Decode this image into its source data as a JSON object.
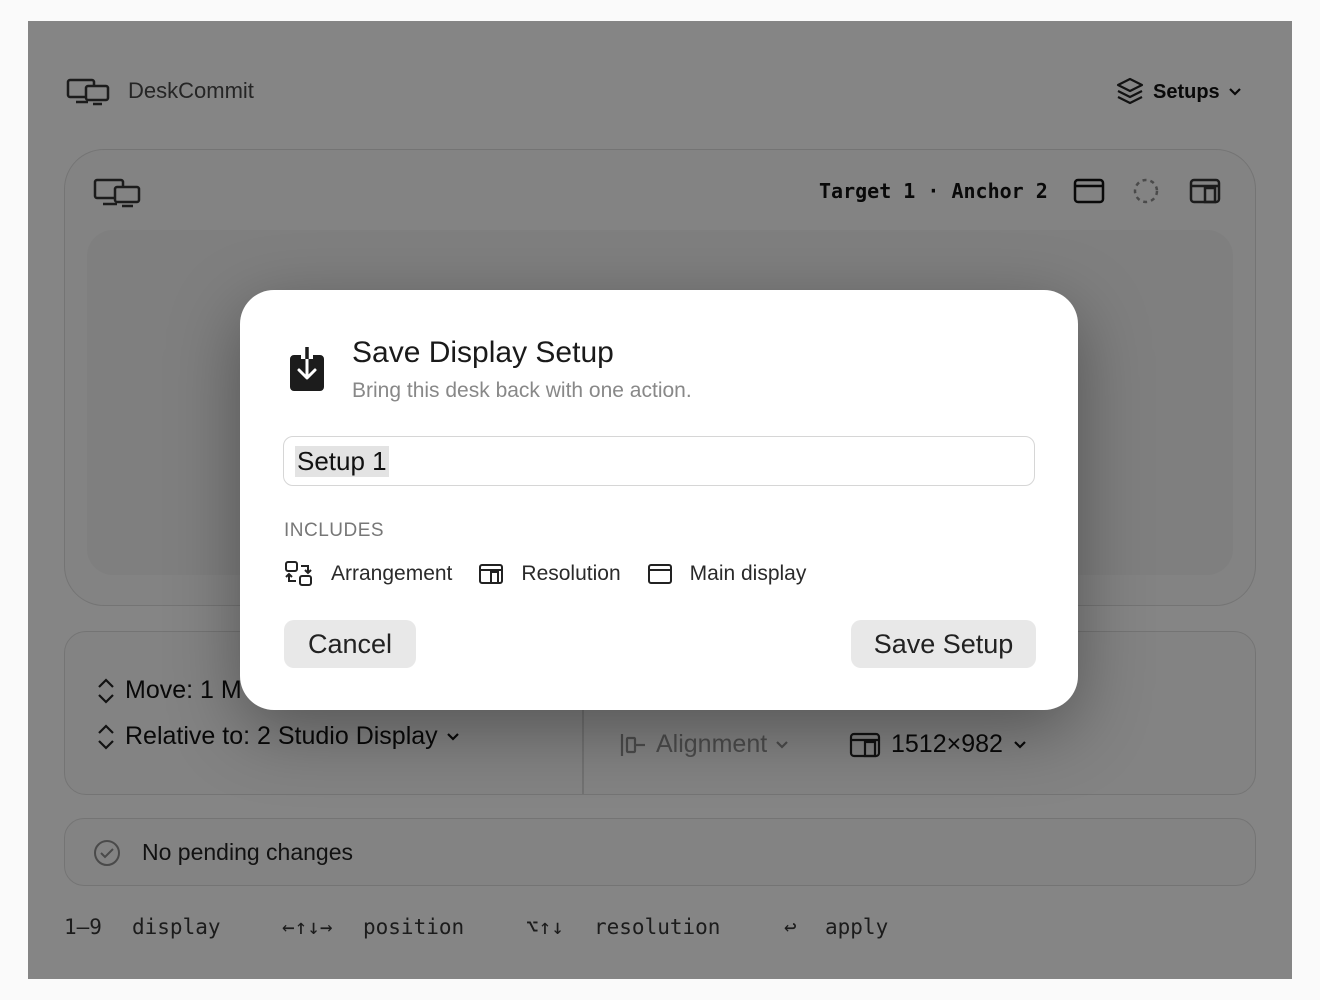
{
  "app": {
    "title": "DeskCommit",
    "setups_label": "Setups"
  },
  "preview": {
    "target_anchor": "Target 1 · Anchor 2"
  },
  "controls": {
    "move_label": "Move: 1 M",
    "relative_label": "Relative to: 2 Studio Display",
    "alignment_label": "Alignment",
    "resolution_value": "1512×982"
  },
  "status": {
    "text": "No pending changes"
  },
  "shortcuts": [
    {
      "key": "1–9",
      "action": "display"
    },
    {
      "key": "←↑↓→",
      "action": "position"
    },
    {
      "key": "⌥↑↓",
      "action": "resolution"
    },
    {
      "key": "↩",
      "action": "apply"
    }
  ],
  "dialog": {
    "title": "Save Display Setup",
    "subtitle": "Bring this desk back with one action.",
    "name_value": "Setup 1",
    "includes_heading": "INCLUDES",
    "includes": [
      "Arrangement",
      "Resolution",
      "Main display"
    ],
    "cancel_label": "Cancel",
    "save_label": "Save Setup"
  },
  "icons": [
    "displays-icon",
    "layers-icon",
    "chevron-down-icon",
    "main-display-icon",
    "spinner-icon",
    "resolution-icon",
    "save-download-icon",
    "arrangement-icon",
    "updown-icon",
    "alignment-icon",
    "check-circle-icon"
  ]
}
